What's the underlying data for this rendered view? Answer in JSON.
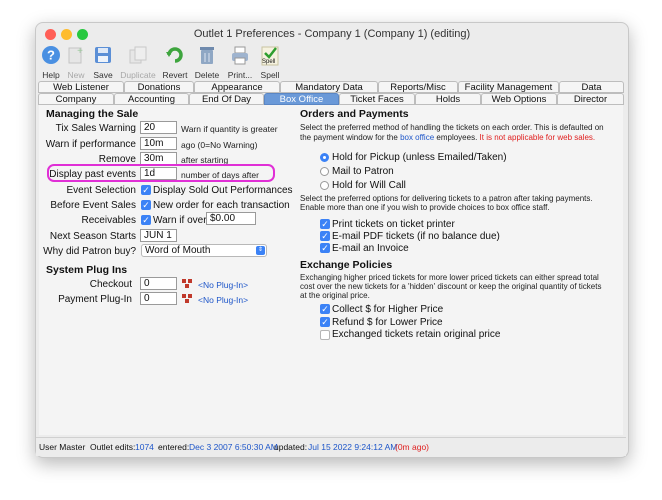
{
  "window": {
    "title": "Outlet 1 Preferences - Company 1 (Company 1) (editing)",
    "colors": {
      "close": "#ff5f57",
      "minimize": "#febc2e",
      "zoom": "#28c840",
      "accent": "#3b82f6",
      "highlight": "#e02fd6",
      "warning": "#e02020",
      "link": "#1e56c9"
    }
  },
  "toolbar": {
    "help": "Help",
    "new": "New",
    "save": "Save",
    "duplicate": "Duplicate",
    "revert": "Revert",
    "delete": "Delete",
    "print": "Print...",
    "spell": "Spell",
    "spell_badge": "Spell"
  },
  "tabs_row1": [
    "Web Listener",
    "Donations",
    "Appearance",
    "Mandatory Data",
    "Reports/Misc",
    "Facility Management",
    "Data Retention"
  ],
  "tabs_row2": [
    "Company",
    "Accounting",
    "End Of Day",
    "Box Office",
    "Ticket Faces",
    "Holds",
    "Web Options",
    "Director"
  ],
  "managing": {
    "header": "Managing the Sale",
    "tix_sales_label": "Tix Sales Warning",
    "tix_sales_value": "20",
    "tix_sales_note": "Warn if quantity is greater",
    "warn_perf_label": "Warn if performance",
    "warn_perf_value": "10m",
    "warn_perf_note": "ago (0=No Warning)",
    "remove_perf_label": "Remove performance",
    "remove_perf_value": "30m",
    "remove_perf_note": "after starting",
    "display_past_label": "Display past events",
    "display_past_value": "1d",
    "display_past_note": "number of days after",
    "event_selection_label": "Event Selection",
    "event_selection_cb": "Display Sold Out Performances",
    "before_event_label": "Before Event Sales",
    "before_event_cb": "New order for each transaction",
    "receivables_label": "Receivables",
    "receivables_cb": "Warn if over",
    "receivables_value": "$0.00",
    "next_season_label": "Next Season Starts",
    "next_season_value": "JUN 1",
    "why_label": "Why did Patron buy?",
    "why_value": "Word of Mouth"
  },
  "plugins": {
    "header": "System Plug Ins",
    "checkout_label": "Checkout",
    "checkout_value": "0",
    "checkout_plugin": "<No Plug-In>",
    "payment_label": "Payment Plug-In",
    "payment_value": "0",
    "payment_plugin": "<No Plug-In>"
  },
  "orders": {
    "header": "Orders and Payments",
    "desc_1": "Select the preferred method of handling the tickets on each order.  This is defaulted on",
    "desc_2a": "the payment window for the ",
    "desc_2b": "box office",
    "desc_2c": " employees.  ",
    "desc_2d": "It is not applicable for web sales.",
    "radio_hold": "Hold for Pickup (unless Emailed/Taken)",
    "radio_mail": "Mail to Patron",
    "radio_will": "Hold for Will Call",
    "selected_method": "Hold for Pickup (unless Emailed/Taken)",
    "desc2_1": "Select the preferred options for delivering tickets to a patron after taking payments.",
    "desc2_2": "Enable more than one if you wish to provide choices to box office staff.",
    "cb_print": "Print tickets on ticket printer",
    "cb_pdf": "E-mail PDF tickets (if no balance due)",
    "cb_invoice": "E-mail an Invoice"
  },
  "exchange": {
    "header": "Exchange Policies",
    "desc_1": "Exchanging higher priced tickets for more lower priced tickets can either spread total",
    "desc_2": "cost over the new tickets for a 'hidden' discount or keep the original quantity of tickets",
    "desc_3": "at the original price.",
    "cb_collect": "Collect $ for Higher Price",
    "cb_refund": "Refund $ for Lower Price",
    "cb_retain": "Exchanged tickets retain original price"
  },
  "status": {
    "user": "User Master",
    "edits_label": "Outlet edits:",
    "edits_value": "1074",
    "entered_label": "entered:",
    "entered_value": "Dec 3 2007 6:50:30 AM",
    "updated_label": "updated:",
    "updated_value": "Jul 15 2022 9:24:12 AM",
    "ago": "(0m ago)"
  }
}
